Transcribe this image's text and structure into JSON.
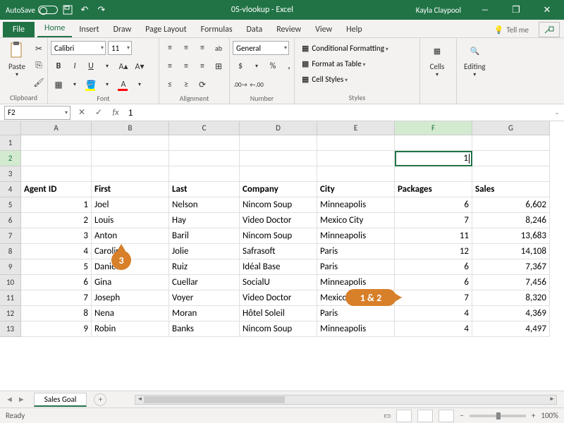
{
  "title": "05-vlookup - Excel",
  "user": "Kayla Claypool",
  "autosave_label": "AutoSave",
  "tabs": {
    "file": "File",
    "home": "Home",
    "insert": "Insert",
    "draw": "Draw",
    "page_layout": "Page Layout",
    "formulas": "Formulas",
    "data": "Data",
    "review": "Review",
    "view": "View",
    "help": "Help"
  },
  "tell_me": "Tell me",
  "ribbon": {
    "clipboard": "Clipboard",
    "paste": "Paste",
    "font": "Font",
    "font_name": "Calibri",
    "font_size": "11",
    "alignment": "Alignment",
    "number": "Number",
    "number_format": "General",
    "styles": "Styles",
    "cond_fmt": "Conditional Formatting",
    "fmt_table": "Format as Table",
    "cell_styles": "Cell Styles",
    "cells": "Cells",
    "editing": "Editing"
  },
  "name_box": "F2",
  "formula_value": "1",
  "columns": [
    "A",
    "B",
    "C",
    "D",
    "E",
    "F",
    "G"
  ],
  "headers": {
    "A": "Agent ID",
    "B": "First",
    "C": "Last",
    "D": "Company",
    "E": "City",
    "F": "Packages",
    "G": "Sales"
  },
  "active_cell_value": "1",
  "rows": [
    {
      "A": "1",
      "B": "Joel",
      "C": "Nelson",
      "D": "Nincom Soup",
      "E": "Minneapolis",
      "F": "6",
      "G": "6,602"
    },
    {
      "A": "2",
      "B": "Louis",
      "C": "Hay",
      "D": "Video Doctor",
      "E": "Mexico City",
      "F": "7",
      "G": "8,246"
    },
    {
      "A": "3",
      "B": "Anton",
      "C": "Baril",
      "D": "Nincom Soup",
      "E": "Minneapolis",
      "F": "11",
      "G": "13,683"
    },
    {
      "A": "4",
      "B": "Caroline",
      "C": "Jolie",
      "D": "Safrasoft",
      "E": "Paris",
      "F": "12",
      "G": "14,108"
    },
    {
      "A": "5",
      "B": "Daniel",
      "C": "Ruiz",
      "D": "Idéal Base",
      "E": "Paris",
      "F": "6",
      "G": "7,367"
    },
    {
      "A": "6",
      "B": "Gina",
      "C": "Cuellar",
      "D": "SocialU",
      "E": "Minneapolis",
      "F": "6",
      "G": "7,456"
    },
    {
      "A": "7",
      "B": "Joseph",
      "C": "Voyer",
      "D": "Video Doctor",
      "E": "Mexico City",
      "F": "7",
      "G": "8,320"
    },
    {
      "A": "8",
      "B": "Nena",
      "C": "Moran",
      "D": "Hôtel Soleil",
      "E": "Paris",
      "F": "4",
      "G": "4,369"
    },
    {
      "A": "9",
      "B": "Robin",
      "C": "Banks",
      "D": "Nincom Soup",
      "E": "Minneapolis",
      "F": "4",
      "G": "4,497"
    }
  ],
  "callouts": {
    "c12": "1 & 2",
    "c3": "3"
  },
  "sheet_name": "Sales Goal",
  "status_text": "Ready",
  "zoom": "100%"
}
